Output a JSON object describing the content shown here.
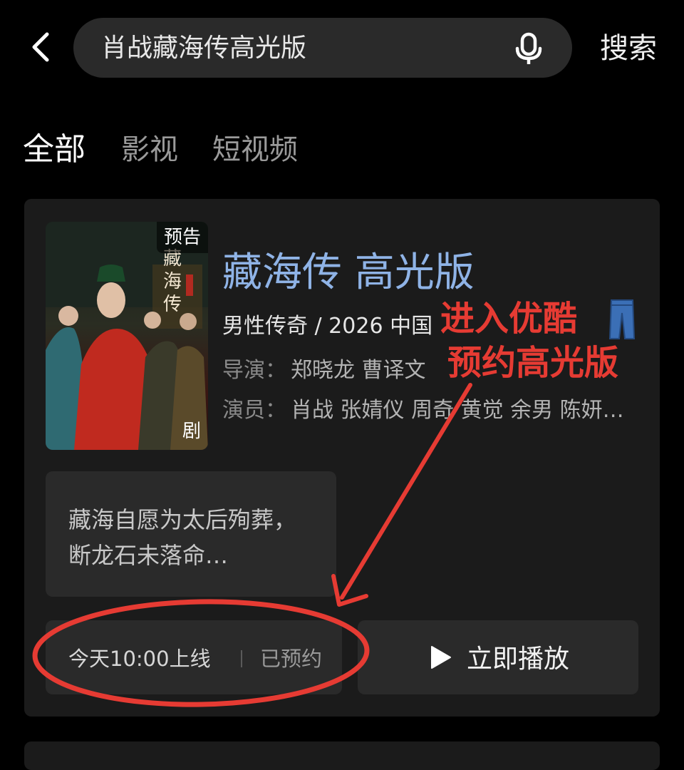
{
  "header": {
    "search_value": "肖战藏海传高光版",
    "search_button_label": "搜索",
    "back_icon": "chevron-left-icon",
    "mic_icon": "microphone-icon"
  },
  "tabs": [
    {
      "label": "全部",
      "active": true
    },
    {
      "label": "影视",
      "active": false
    },
    {
      "label": "短视频",
      "active": false
    }
  ],
  "result": {
    "poster_badge": "预告",
    "poster_corner_label": "剧",
    "title": "藏海传 高光版",
    "genre_line": "男性传奇 / 2026 中国",
    "director_label": "导演：",
    "director_names": "郑晓龙 曹译文",
    "cast_label": "演员：",
    "cast_names": "肖战 张婧仪 周奇 黄觉 余男 陈妍…",
    "synopsis": "藏海自愿为太后殉葬，断龙石未落命…",
    "release_time": "今天10:00上线",
    "reservation_status": "已预约",
    "play_button_label": "立即播放"
  },
  "annotation": {
    "line1": "进入优酷",
    "line2": "预约高光版",
    "emoji_icon": "jeans-icon",
    "color": "#e63b33"
  },
  "colors": {
    "background": "#000000",
    "card": "#1b1b1b",
    "title_blue": "#8fb3e6"
  }
}
